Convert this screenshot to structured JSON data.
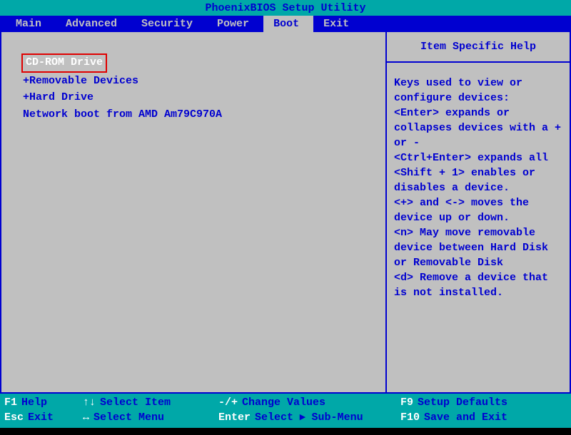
{
  "title": "PhoenixBIOS Setup Utility",
  "menu": {
    "items": [
      "Main",
      "Advanced",
      "Security",
      "Power",
      "Boot",
      "Exit"
    ],
    "active_index": 4
  },
  "boot_list": [
    {
      "label": "CD-ROM Drive",
      "selected": true,
      "expandable": false
    },
    {
      "label": "+Removable Devices",
      "selected": false,
      "expandable": true
    },
    {
      "label": "+Hard Drive",
      "selected": false,
      "expandable": true
    },
    {
      "label": " Network boot from AMD Am79C970A",
      "selected": false,
      "expandable": false
    }
  ],
  "help": {
    "title": "Item Specific Help",
    "body": "Keys used to view or configure devices:\n<Enter> expands or collapses devices with a + or -\n<Ctrl+Enter> expands all\n<Shift + 1> enables or disables a device.\n<+> and <-> moves the device up or down.\n<n> May move removable device between Hard Disk or Removable Disk\n<d> Remove a device that is not installed."
  },
  "footer": {
    "rows": [
      [
        {
          "key": "F1",
          "label": "Help"
        },
        {
          "key": "↑↓",
          "label": "Select Item"
        },
        {
          "key": "-/+",
          "label": "Change Values"
        },
        {
          "key": "F9",
          "label": "Setup Defaults"
        }
      ],
      [
        {
          "key": "Esc",
          "label": "Exit"
        },
        {
          "key": "↔",
          "label": "Select Menu"
        },
        {
          "key": "Enter",
          "label": "Select ▸ Sub-Menu"
        },
        {
          "key": "F10",
          "label": "Save and Exit"
        }
      ]
    ]
  }
}
